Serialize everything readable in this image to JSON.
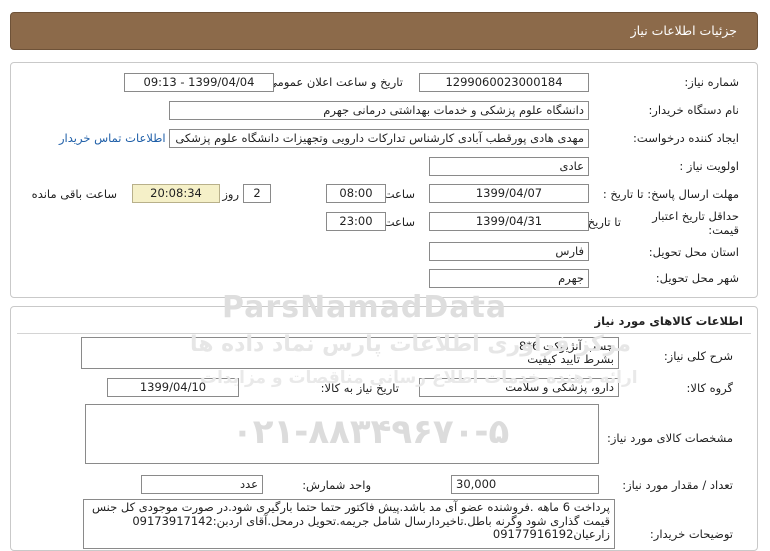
{
  "header": {
    "title": "جزئیات اطلاعات نیاز"
  },
  "details": {
    "need_number_label": "شماره نیاز:",
    "need_number": "1299060023000184",
    "announce_label": "تاریخ و ساعت اعلان عمومی:",
    "announce_value": "1399/04/04 - 09:13",
    "buyer_org_label": "نام دستگاه خریدار:",
    "buyer_org": "دانشگاه علوم پزشکی و خدمات بهداشتی درمانی جهرم",
    "creator_label": "ایجاد کننده درخواست:",
    "creator": "مهدی هادی پورقطب آبادی کارشناس تدارکات دارویی وتجهیزات دانشگاه علوم پزشکی",
    "contact_link": "اطلاعات تماس خریدار",
    "priority_label": "اولویت نیاز :",
    "priority": "عادی",
    "send_deadline_label": "مهلت ارسال پاسخ: تا تاریخ :",
    "send_date": "1399/04/07",
    "time_label": "ساعت",
    "send_time": "08:00",
    "days_value": "2",
    "days_label": "روز و",
    "remaining_time": "20:08:34",
    "remaining_label": "ساعت باقی مانده",
    "validity_label": "حداقل تاریخ اعتبار قیمت:",
    "to_date_label": "تا تاریخ :",
    "validity_date": "1399/04/31",
    "validity_time": "23:00",
    "province_label": "استان محل تحویل:",
    "province": "فارس",
    "city_label": "شهر محل تحویل:",
    "city": "جهرم"
  },
  "goods": {
    "section_title": "اطلاعات کالاهای مورد نیاز",
    "summary_label": "شرح کلی نیاز:",
    "summary_line1": "چسب آنژیوکت 6*8",
    "summary_line2": "بشرط تایید کیفیت",
    "group_label": "گروه کالا:",
    "group": "دارو، پزشکی و سلامت",
    "need_date_label": "تاریخ نیاز به کالا:",
    "need_date": "1399/04/10",
    "specs_label": "مشخصات کالای مورد نیاز:",
    "specs": "",
    "qty_label": "تعداد / مقدار مورد نیاز:",
    "qty": "30,000",
    "unit_label": "واحد شمارش:",
    "unit": "عدد",
    "buyer_notes_label": "توضیحات خریدار:",
    "buyer_notes": "پرداخت 6 ماهه .فروشنده عضو آی مد باشد.پیش فاکتور حتما حتما بارگیری شود.در صورت موجودی کل جنس قیمت گذاری شود وگرنه باطل.تاخیردارسال شامل جریمه.تحویل درمحل.آقای اردبن:09173917142 زارعیان09177916192"
  },
  "watermark": {
    "brand": "ParsNamadData",
    "sub": "مرکز فراوری اطلاعات پارس نماد داده ها",
    "sub2": "ارائه دهنده خدمات اطلاع رسانی مناقصات و مزایدات",
    "phone": "۰۲۱-۸۸۳۴۹۶۷۰-۵"
  }
}
